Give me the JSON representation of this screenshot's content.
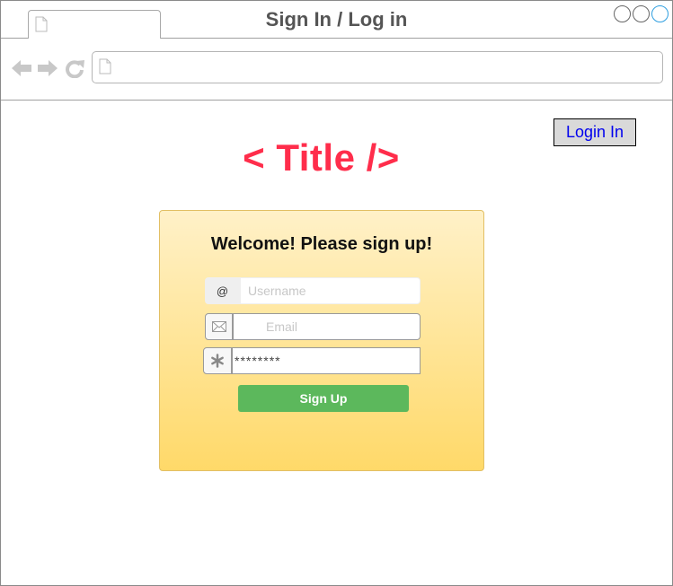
{
  "window": {
    "title": "Sign In / Log in"
  },
  "address_bar": {
    "value": ""
  },
  "header": {
    "login_label": "Login In"
  },
  "page": {
    "title": "< Title />"
  },
  "signup_form": {
    "heading": "Welcome! Please sign up!",
    "username": {
      "addon": "@",
      "placeholder": "Username",
      "value": ""
    },
    "email": {
      "placeholder": "Email",
      "value": ""
    },
    "password": {
      "value": "********"
    },
    "submit_label": "Sign Up"
  },
  "colors": {
    "title_accent": "#ff2d4b",
    "submit_button": "#5cb85c",
    "login_link": "#0000ee"
  }
}
